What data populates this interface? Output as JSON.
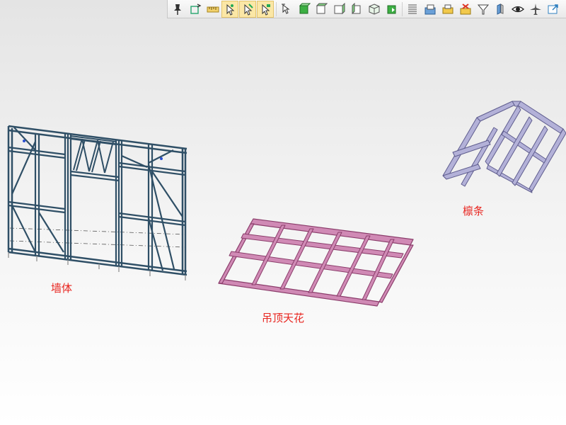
{
  "toolbar": {
    "buttons": [
      {
        "name": "pin-icon",
        "active": false
      },
      {
        "name": "rotate-view-icon",
        "active": false
      },
      {
        "name": "ruler-icon",
        "active": false
      },
      {
        "name": "select-point-icon",
        "active": true
      },
      {
        "name": "select-edge-icon",
        "active": true
      },
      {
        "name": "select-face-icon",
        "active": true
      },
      {
        "name": "select-mode-icon",
        "active": false
      },
      {
        "name": "view-front-icon",
        "active": false
      },
      {
        "name": "view-back-icon",
        "active": false
      },
      {
        "name": "view-left-icon",
        "active": false
      },
      {
        "name": "view-right-icon",
        "active": false
      },
      {
        "name": "view-iso-icon",
        "active": false
      },
      {
        "name": "view-green-cube-icon",
        "active": false
      },
      {
        "name": "list-icon",
        "active": false
      },
      {
        "name": "layer-icon",
        "active": false
      },
      {
        "name": "print-icon",
        "active": false
      },
      {
        "name": "delete-icon",
        "active": false
      },
      {
        "name": "filter-icon",
        "active": false
      },
      {
        "name": "section-icon",
        "active": false
      },
      {
        "name": "eye-icon",
        "active": false
      },
      {
        "name": "fly-icon",
        "active": false
      },
      {
        "name": "export-icon",
        "active": false
      }
    ]
  },
  "labels": {
    "wall": "墙体",
    "ceiling": "吊顶天花",
    "purlin": "檩条"
  },
  "colors": {
    "wall_frame": "#2f4f66",
    "ceiling_frame": "#8b3d6b",
    "purlin_frame": "#8a88b8",
    "label_red": "#e8251f"
  }
}
